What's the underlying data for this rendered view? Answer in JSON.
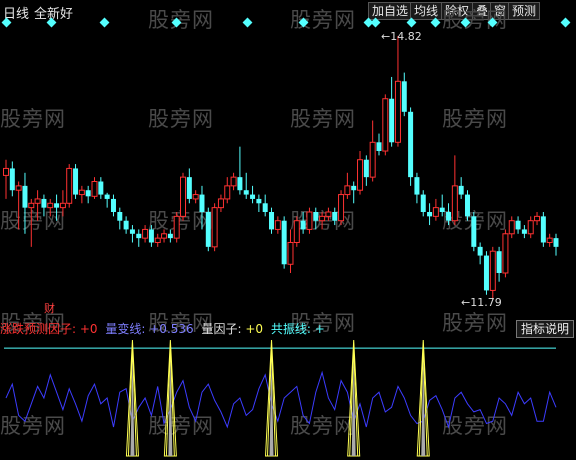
{
  "toolbar": {
    "period": "日线",
    "name": "全新好",
    "buttons": [
      "加自选",
      "均线",
      "除权",
      "叠",
      "窗",
      "预测"
    ]
  },
  "watermark": "股旁网",
  "price_labels": {
    "high": "14.82",
    "low": "11.79"
  },
  "marker_text": "财",
  "indicator": {
    "title": "涨跌预测因子: ",
    "title_val": "+0",
    "liangbian_label": "量变线: ",
    "liangbian_val": "+0.536",
    "liangyinzi_label": "量因子: ",
    "liangyinzi_val": "+0",
    "gongzhen_label": "共振线: ",
    "gongzhen_val": "+",
    "help_button": "指标说明"
  },
  "colors": {
    "up": "#ff3232",
    "down": "#54ffff",
    "blue_line": "#3c3cff",
    "yellow_line": "#ffff54",
    "ref_line": "#54ffff",
    "diamond": "#54ffff"
  },
  "chart_data": {
    "type": "candlestick",
    "price_high": 14.82,
    "price_low": 11.79,
    "candles": [
      [
        13.22,
        13.3,
        13.4,
        12.95,
        1
      ],
      [
        13.3,
        13.05,
        13.38,
        12.98,
        -1
      ],
      [
        13.05,
        13.1,
        13.15,
        12.6,
        1
      ],
      [
        13.1,
        12.85,
        13.25,
        12.55,
        -1
      ],
      [
        12.85,
        12.9,
        12.95,
        12.4,
        1
      ],
      [
        12.9,
        12.95,
        13.05,
        12.7,
        1
      ],
      [
        12.95,
        12.85,
        13.0,
        12.75,
        -1
      ],
      [
        12.85,
        12.9,
        12.95,
        12.75,
        1
      ],
      [
        12.9,
        12.85,
        13.0,
        12.7,
        -1
      ],
      [
        12.85,
        12.9,
        13.05,
        12.75,
        1
      ],
      [
        12.9,
        13.3,
        13.35,
        12.85,
        1
      ],
      [
        13.3,
        13.0,
        13.35,
        12.95,
        -1
      ],
      [
        13.0,
        13.05,
        13.1,
        12.9,
        1
      ],
      [
        13.05,
        12.98,
        13.1,
        12.9,
        -1
      ],
      [
        12.98,
        13.15,
        13.2,
        12.95,
        1
      ],
      [
        13.15,
        13.0,
        13.2,
        12.95,
        -1
      ],
      [
        13.0,
        12.95,
        13.02,
        12.85,
        -1
      ],
      [
        12.95,
        12.8,
        13.0,
        12.75,
        -1
      ],
      [
        12.8,
        12.7,
        12.85,
        12.6,
        -1
      ],
      [
        12.7,
        12.6,
        12.75,
        12.55,
        -1
      ],
      [
        12.6,
        12.55,
        12.65,
        12.45,
        -1
      ],
      [
        12.55,
        12.5,
        12.6,
        12.4,
        -1
      ],
      [
        12.5,
        12.6,
        12.65,
        12.45,
        1
      ],
      [
        12.6,
        12.45,
        12.65,
        12.4,
        -1
      ],
      [
        12.45,
        12.5,
        12.55,
        12.4,
        1
      ],
      [
        12.5,
        12.55,
        12.6,
        12.45,
        1
      ],
      [
        12.55,
        12.5,
        12.6,
        12.45,
        -1
      ],
      [
        12.5,
        12.75,
        12.8,
        12.45,
        1
      ],
      [
        12.75,
        13.2,
        13.25,
        12.7,
        1
      ],
      [
        13.2,
        12.95,
        13.3,
        12.9,
        -1
      ],
      [
        12.95,
        13.0,
        13.05,
        12.9,
        1
      ],
      [
        13.0,
        12.8,
        13.1,
        12.6,
        -1
      ],
      [
        12.8,
        12.4,
        12.85,
        12.35,
        -1
      ],
      [
        12.4,
        12.85,
        12.9,
        12.35,
        1
      ],
      [
        12.85,
        12.95,
        13.0,
        12.8,
        1
      ],
      [
        12.95,
        13.1,
        13.2,
        12.9,
        1
      ],
      [
        13.1,
        13.2,
        13.25,
        13.05,
        1
      ],
      [
        13.2,
        13.05,
        13.55,
        13.0,
        -1
      ],
      [
        13.05,
        13.0,
        13.25,
        12.95,
        -1
      ],
      [
        13.0,
        12.95,
        13.1,
        12.9,
        -1
      ],
      [
        12.95,
        12.9,
        13.0,
        12.8,
        -1
      ],
      [
        12.9,
        12.8,
        13.0,
        12.75,
        -1
      ],
      [
        12.8,
        12.6,
        12.85,
        12.55,
        -1
      ],
      [
        12.6,
        12.7,
        12.75,
        12.55,
        1
      ],
      [
        12.7,
        12.2,
        12.75,
        12.15,
        -1
      ],
      [
        12.2,
        12.45,
        12.6,
        12.1,
        1
      ],
      [
        12.45,
        12.7,
        12.75,
        12.4,
        1
      ],
      [
        12.7,
        12.6,
        12.8,
        12.55,
        -1
      ],
      [
        12.6,
        12.8,
        12.85,
        12.55,
        1
      ],
      [
        12.8,
        12.7,
        12.85,
        12.6,
        -1
      ],
      [
        12.7,
        12.75,
        12.8,
        12.6,
        1
      ],
      [
        12.75,
        12.8,
        12.85,
        12.7,
        1
      ],
      [
        12.8,
        12.7,
        12.85,
        12.65,
        -1
      ],
      [
        12.7,
        13.0,
        13.05,
        12.65,
        1
      ],
      [
        13.0,
        13.1,
        13.25,
        12.95,
        1
      ],
      [
        13.1,
        13.05,
        13.15,
        12.9,
        -1
      ],
      [
        13.05,
        13.4,
        13.5,
        13.0,
        1
      ],
      [
        13.4,
        13.2,
        13.45,
        13.1,
        -1
      ],
      [
        13.2,
        13.6,
        13.85,
        13.15,
        1
      ],
      [
        13.6,
        13.5,
        13.7,
        13.45,
        -1
      ],
      [
        13.5,
        14.1,
        14.15,
        13.45,
        1
      ],
      [
        14.1,
        13.6,
        14.35,
        13.55,
        -1
      ],
      [
        13.6,
        14.3,
        14.82,
        13.55,
        1
      ],
      [
        14.3,
        13.95,
        14.4,
        13.9,
        -1
      ],
      [
        13.95,
        13.2,
        14.0,
        13.1,
        -1
      ],
      [
        13.2,
        13.0,
        13.25,
        12.9,
        -1
      ],
      [
        13.0,
        12.8,
        13.05,
        12.75,
        -1
      ],
      [
        12.8,
        12.75,
        12.9,
        12.65,
        -1
      ],
      [
        12.75,
        12.85,
        12.95,
        12.7,
        1
      ],
      [
        12.85,
        12.8,
        13.0,
        12.75,
        -1
      ],
      [
        12.8,
        12.7,
        12.9,
        12.65,
        -1
      ],
      [
        12.7,
        13.1,
        13.45,
        12.65,
        1
      ],
      [
        13.1,
        13.0,
        13.2,
        12.95,
        -1
      ],
      [
        13.0,
        12.75,
        13.05,
        12.7,
        -1
      ],
      [
        12.75,
        12.4,
        12.8,
        12.35,
        -1
      ],
      [
        12.4,
        12.3,
        12.45,
        12.2,
        -1
      ],
      [
        12.3,
        11.9,
        12.35,
        11.85,
        -1
      ],
      [
        11.9,
        12.35,
        12.4,
        11.79,
        1
      ],
      [
        12.35,
        12.1,
        12.4,
        12.0,
        -1
      ],
      [
        12.1,
        12.55,
        12.6,
        12.05,
        1
      ],
      [
        12.55,
        12.7,
        12.75,
        12.5,
        1
      ],
      [
        12.7,
        12.6,
        12.75,
        12.55,
        -1
      ],
      [
        12.6,
        12.55,
        12.65,
        12.5,
        -1
      ],
      [
        12.55,
        12.7,
        12.75,
        12.5,
        1
      ],
      [
        12.7,
        12.75,
        12.8,
        12.65,
        1
      ],
      [
        12.75,
        12.45,
        12.8,
        12.4,
        -1
      ],
      [
        12.45,
        12.5,
        12.55,
        12.4,
        1
      ],
      [
        12.5,
        12.4,
        12.55,
        12.3,
        -1
      ]
    ],
    "indicator_blue": [
      0.5,
      0.62,
      0.35,
      0.3,
      0.45,
      0.6,
      0.5,
      0.7,
      0.55,
      0.4,
      0.58,
      0.45,
      0.3,
      0.52,
      0.62,
      0.45,
      0.5,
      0.25,
      0.55,
      0.58,
      0.3,
      0.42,
      0.5,
      0.35,
      0.6,
      0.28,
      0.4,
      0.55,
      0.65,
      0.42,
      0.3,
      0.55,
      0.62,
      0.48,
      0.38,
      0.25,
      0.45,
      0.5,
      0.35,
      0.4,
      0.58,
      0.7,
      0.45,
      0.3,
      0.5,
      0.55,
      0.6,
      0.35,
      0.28,
      0.55,
      0.72,
      0.5,
      0.4,
      0.65,
      0.55,
      0.3,
      0.45,
      0.25,
      0.5,
      0.55,
      0.38,
      0.42,
      0.6,
      0.5,
      0.35,
      0.28,
      0.3,
      0.48,
      0.52,
      0.4,
      0.25,
      0.5,
      0.55,
      0.45,
      0.38,
      0.4,
      0.28,
      0.3,
      0.5,
      0.45,
      0.35,
      0.55,
      0.45,
      0.5,
      0.3,
      0.3,
      0.55,
      0.42
    ],
    "indicator_ref_level": 0.93,
    "resonance_spikes": [
      20,
      26,
      42,
      55,
      66
    ]
  }
}
